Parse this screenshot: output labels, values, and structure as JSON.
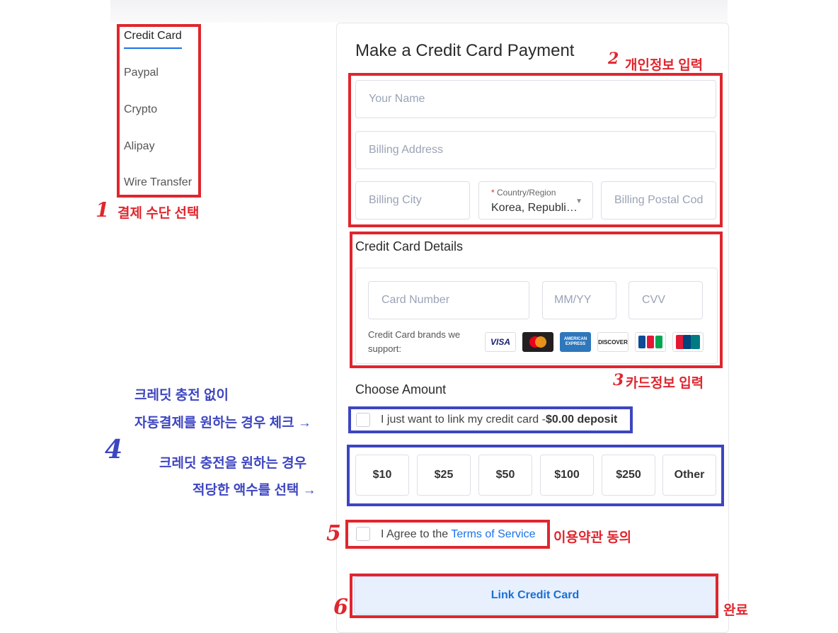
{
  "nav": {
    "items": [
      {
        "label": "Credit Card",
        "active": true
      },
      {
        "label": "Paypal"
      },
      {
        "label": "Crypto"
      },
      {
        "label": "Alipay"
      },
      {
        "label": "Wire Transfer"
      }
    ]
  },
  "form": {
    "title": "Make a Credit Card Payment",
    "name_placeholder": "Your Name",
    "address_placeholder": "Billing Address",
    "city_placeholder": "Billing City",
    "country_label_required": "*",
    "country_label": "Country/Region",
    "country_value": "Korea, Republi…",
    "postal_placeholder": "Billing Postal Cod"
  },
  "card": {
    "section_title": "Credit Card Details",
    "number_placeholder": "Card Number",
    "expiry_placeholder": "MM/YY",
    "cvv_placeholder": "CVV",
    "brands_text": "Credit Card brands we support:",
    "brands": [
      "VISA",
      "MasterCard",
      "AMERICAN EXPRESS",
      "DISCOVER",
      "JCB",
      "UnionPay"
    ]
  },
  "amount": {
    "section_title": "Choose Amount",
    "link_only_text": "I just want to link my credit card -",
    "link_only_bold": "$0.00 deposit",
    "options": [
      "$10",
      "$25",
      "$50",
      "$100",
      "$250",
      "Other"
    ]
  },
  "terms": {
    "prefix": "I Agree to the ",
    "link": "Terms of Service"
  },
  "submit_label": "Link Credit Card",
  "annotations": {
    "n1": "1",
    "note1": "결제 수단 선택",
    "n2": "2",
    "note2": "개인정보 입력",
    "n3": "3",
    "note3": "카드정보 입력",
    "note4a_line1": "크레딧 충전 없이",
    "note4a_line2": "자동결제를 원하는 경우 체크 →",
    "n4": "4",
    "note4b_line1": "크레딧 충전을 원하는 경우",
    "note4b_line2": "적당한 액수를 선택 →",
    "n5": "5",
    "note5": "이용약관 동의",
    "n6": "6",
    "note6": "완료"
  }
}
